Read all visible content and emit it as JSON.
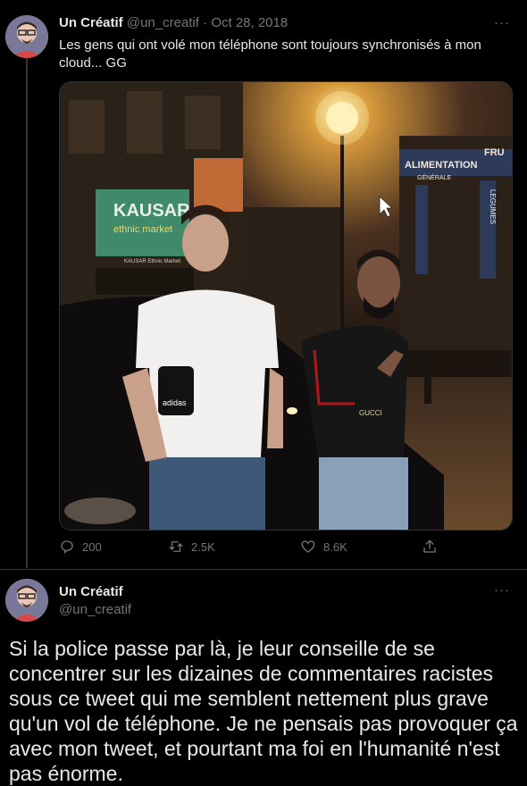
{
  "tweet1": {
    "display_name": "Un Créatif",
    "handle": "@un_creatif",
    "separator": "·",
    "date": "Oct 28, 2018",
    "text": "Les gens qui ont volé mon téléphone sont toujours synchronisés à mon cloud... GG",
    "more_label": "···",
    "photo_signs": {
      "shop_name": "KAUSAR",
      "shop_sub": "ethnic market",
      "shop_small": "KAUSAR Ethnic Market",
      "alimentation": "ALIMENTATION",
      "fru": "FRU",
      "generale": "GÉNÉRALE",
      "legumes": "LEGUMES",
      "bag_brand": "adidas",
      "shirt_brand": "GUCCI"
    },
    "stats": {
      "replies": "200",
      "retweets": "2.5K",
      "likes": "8.6K"
    },
    "icons": [
      "reply-icon",
      "retweet-icon",
      "like-icon",
      "share-icon"
    ]
  },
  "tweet2": {
    "display_name": "Un Créatif",
    "handle": "@un_creatif",
    "more_label": "···",
    "text": "Si la police passe par là, je leur conseille de se concentrer sur les dizaines de commentaires racistes sous ce tweet qui me semblent nettement plus grave qu'un vol de téléphone. Je ne pensais pas provoquer ça avec mon tweet, et pourtant ma foi en l'humanité n'est pas énorme."
  },
  "colors": {
    "background": "#000000",
    "text": "#e7e9ea",
    "muted": "#71767b",
    "border": "#2f3336"
  }
}
